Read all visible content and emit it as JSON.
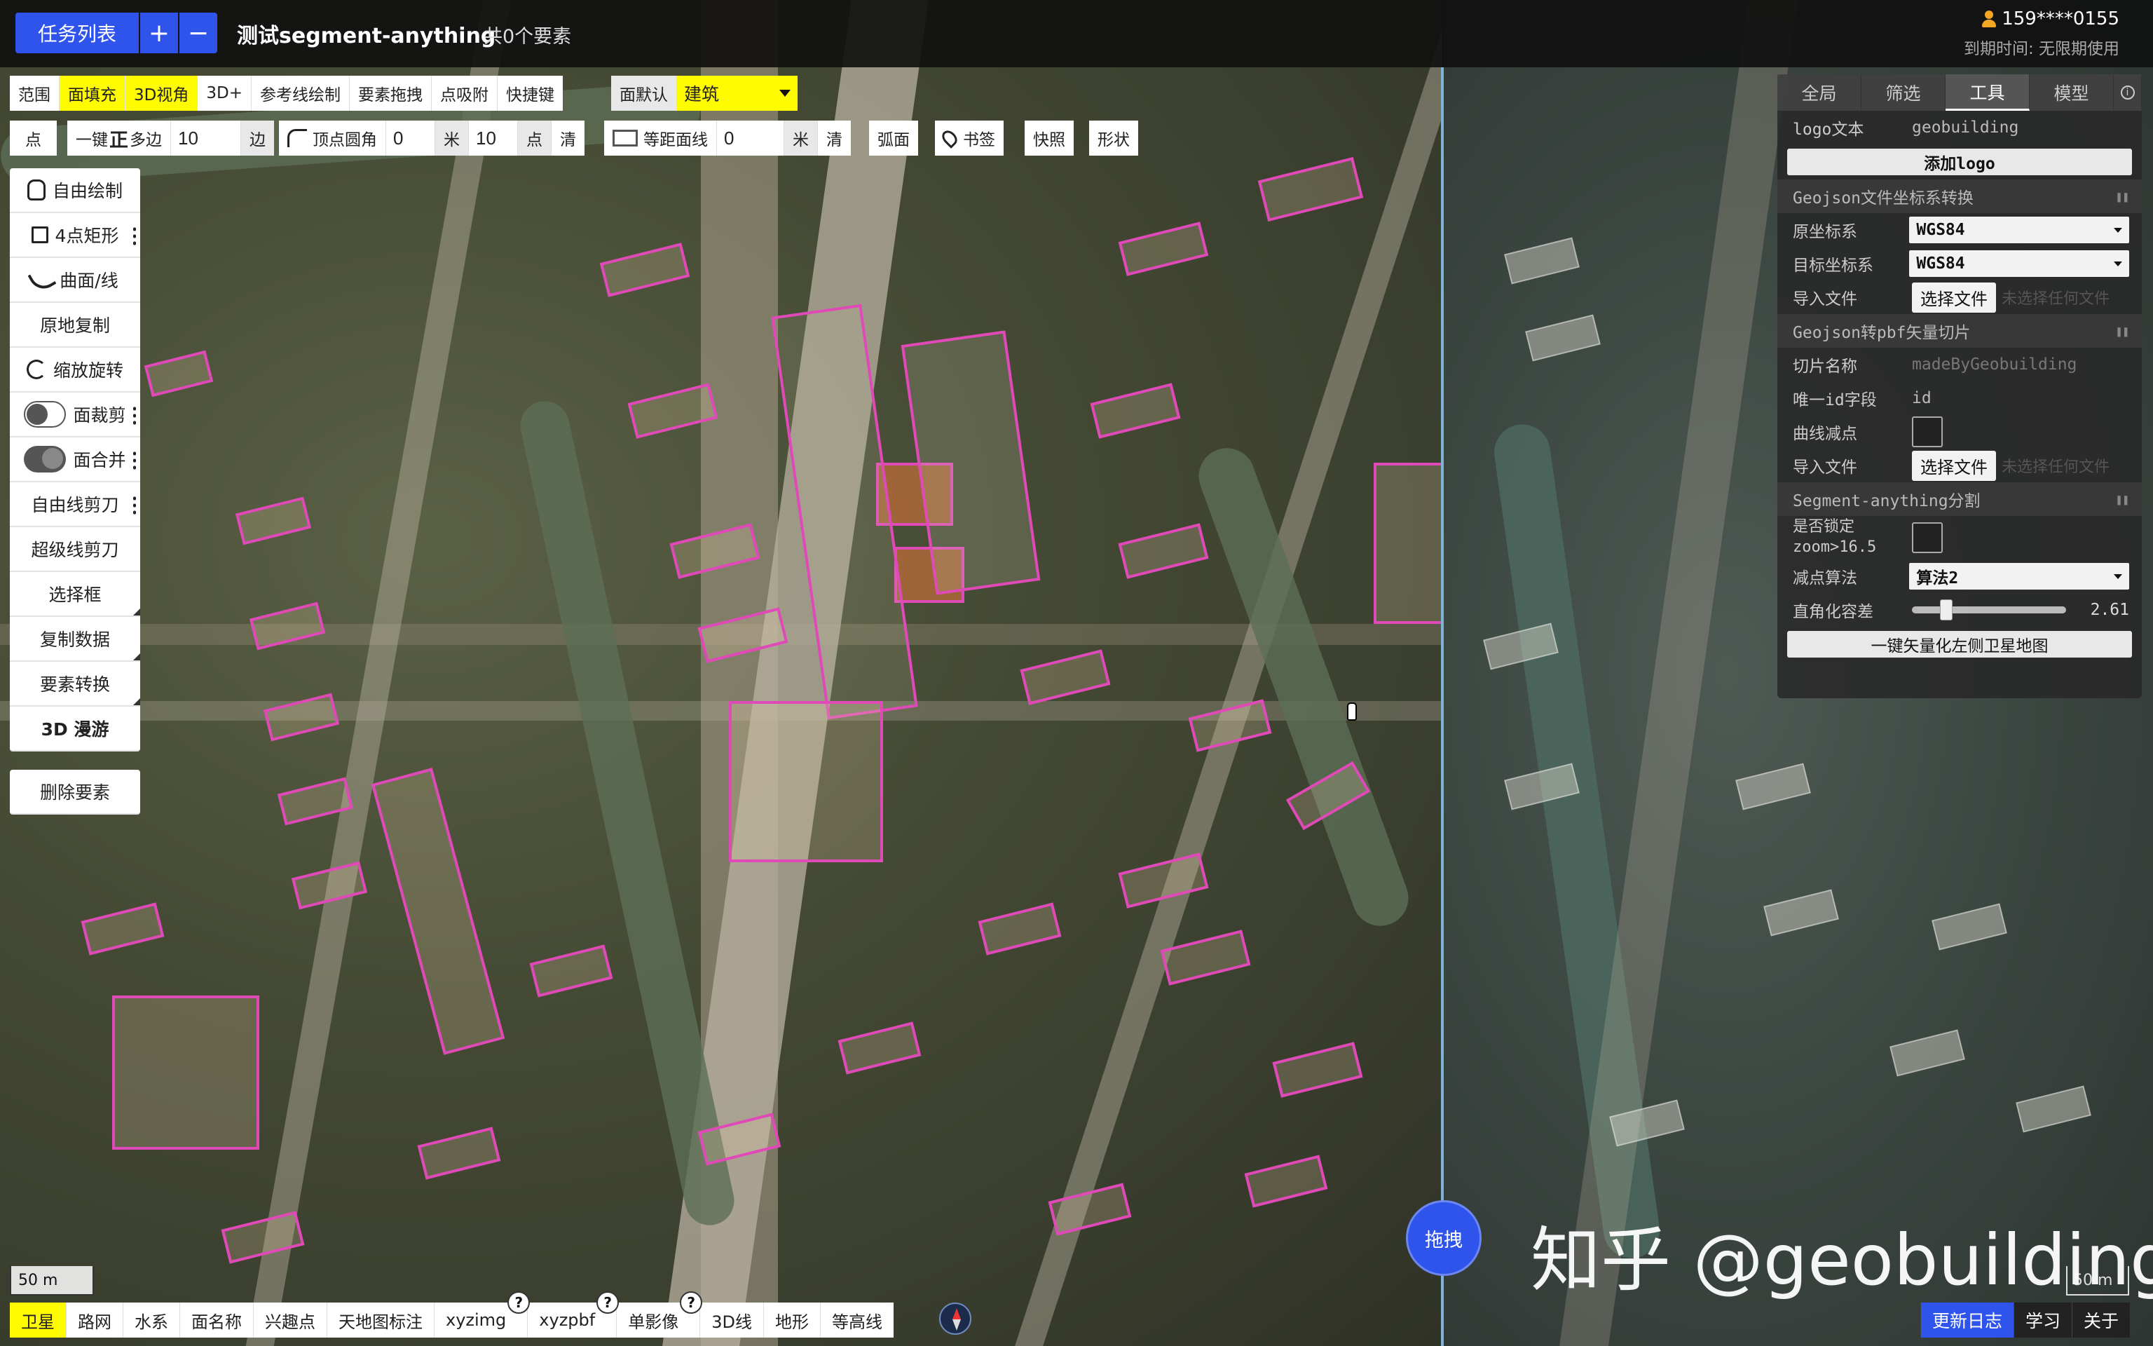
{
  "header": {
    "task_list_label": "任务列表",
    "add_label": "+",
    "remove_label": "−",
    "title": "测试segment-anything",
    "element_count": "共0个要素",
    "user": "159****0155",
    "expiry": "到期时间: 无限期使用"
  },
  "toolbar_row1": {
    "range": "范围",
    "fill": "面填充",
    "view3d": "3D视角",
    "plus3d": "3D+",
    "ref_line": "参考线绘制",
    "drag": "要素拖拽",
    "snap": "点吸附",
    "hotkey": "快捷键",
    "face_default": "面默认",
    "category": "建筑"
  },
  "toolbar_row2": {
    "point": "点",
    "one_key": "一键",
    "zheng": "正",
    "polygon": "多边",
    "sides_value": "10",
    "sides_unit": "边",
    "vertex_round": "顶点圆角",
    "round_value": "0",
    "round_unit": "米",
    "points_value": "10",
    "points_unit": "点",
    "clear1": "清",
    "equidistant": "等距面线",
    "equi_value": "0",
    "equi_unit": "米",
    "clear2": "清",
    "arc": "弧面",
    "bookmark": "书签",
    "snapshot": "快照",
    "shape": "形状"
  },
  "side_panel": {
    "free_draw": "自由绘制",
    "rect4": "4点矩形",
    "curve": "曲面/线",
    "copy_in_place": "原地复制",
    "scale_rotate": "缩放旋转",
    "face_clip": "面裁剪",
    "face_merge": "面合并",
    "free_cut": "自由线剪刀",
    "super_cut": "超级线剪刀",
    "select_box": "选择框",
    "copy_data": "复制数据",
    "convert": "要素转换",
    "roam3d": "3D 漫游",
    "delete": "删除要素"
  },
  "right_panel": {
    "tabs": [
      "全局",
      "筛选",
      "工具",
      "模型"
    ],
    "logo_text_label": "logo文本",
    "logo_text_value": "geobuilding",
    "add_logo": "添加logo",
    "geojson_convert_title": "Geojson文件坐标系转换",
    "src_crs_label": "原坐标系",
    "src_crs_value": "WGS84",
    "dst_crs_label": "目标坐标系",
    "dst_crs_value": "WGS84",
    "import_file_label": "导入文件",
    "choose_file": "选择文件",
    "no_file": "未选择任何文件",
    "pbf_title": "Geojson转pbf矢量切片",
    "tile_name_label": "切片名称",
    "tile_name_placeholder": "madeByGeobuilding",
    "unique_id_label": "唯一id字段",
    "unique_id_value": "id",
    "curve_reduce_label": "曲线减点",
    "import_file2_label": "导入文件",
    "sam_title": "Segment-anything分割",
    "lock_label_1": "是否锁定",
    "lock_label_2": "zoom>16.5",
    "reduce_algo_label": "减点算法",
    "reduce_algo_value": "算法2",
    "right_angle_label": "直角化容差",
    "right_angle_value": "2.61",
    "vectorize_btn": "一键矢量化左侧卫星地图"
  },
  "bottom_bar": {
    "layers": [
      "卫星",
      "路网",
      "水系",
      "面名称",
      "兴趣点",
      "天地图标注",
      "xyzimg",
      "xyzpbf",
      "单影像",
      "3D线",
      "地形",
      "等高线"
    ],
    "help": "?",
    "scale_left": "50 m",
    "scale_right": "50 m",
    "drag": "拖拽",
    "update_log": "更新日志",
    "learn": "学习",
    "about": "关于",
    "watermark": "知乎 @geobuilding"
  },
  "colors": {
    "accent_blue": "#2f54eb",
    "highlight_yellow": "#fffb00",
    "polygon_pink": "#e049b8"
  }
}
